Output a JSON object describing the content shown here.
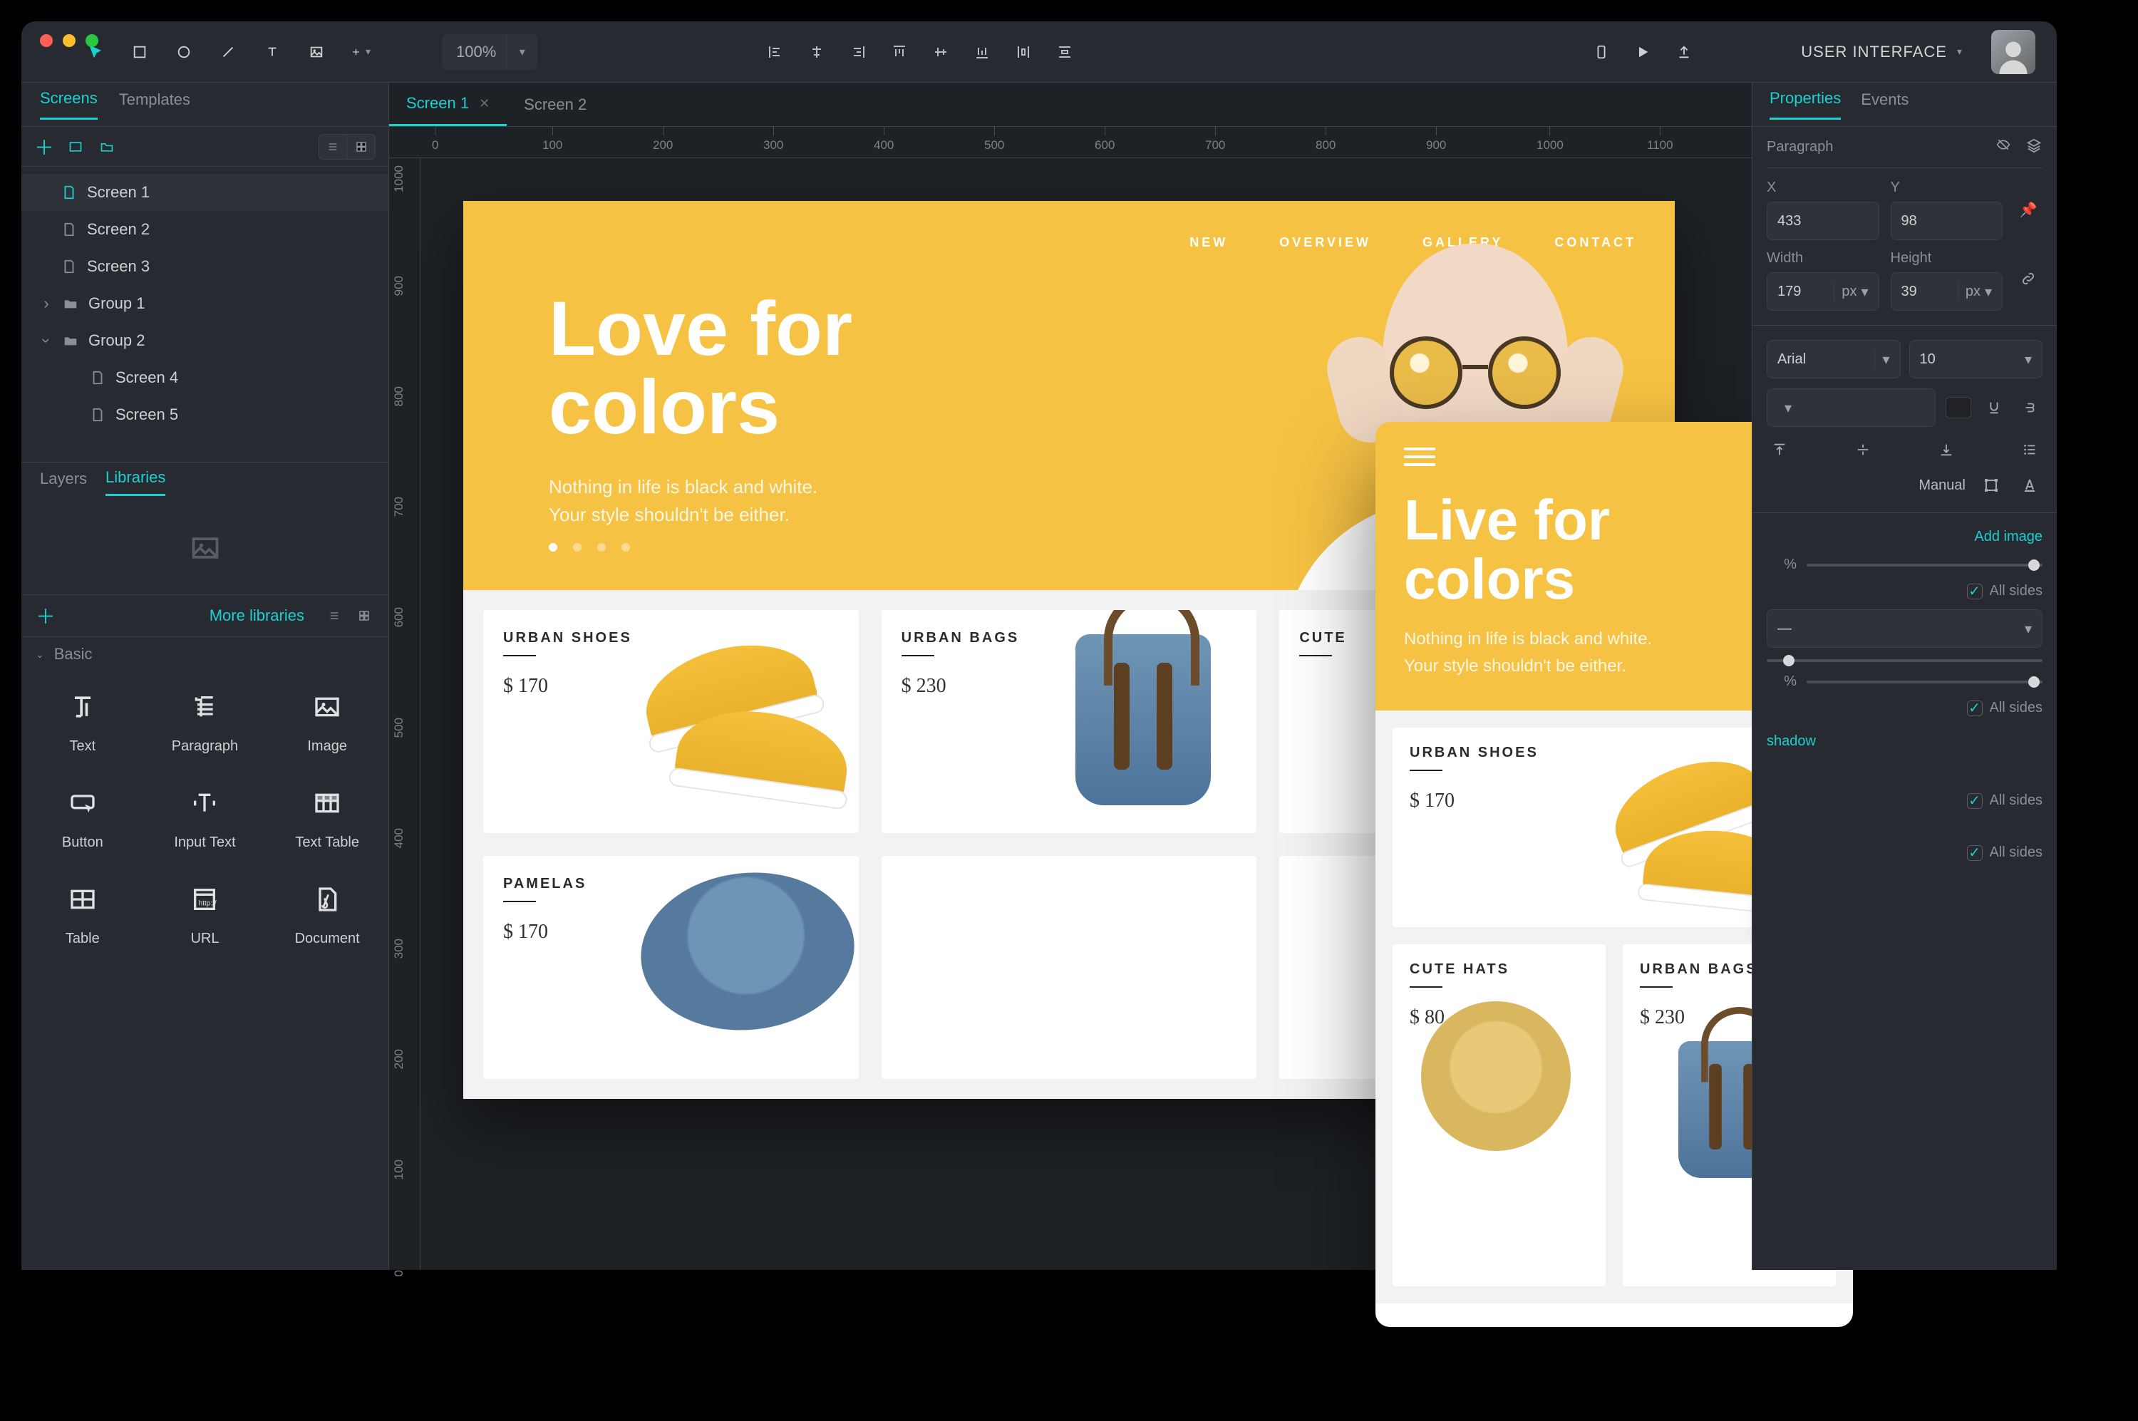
{
  "topbar": {
    "zoom": "100%",
    "mode": "USER INTERFACE"
  },
  "leftPanel": {
    "tabs": [
      "Screens",
      "Templates"
    ],
    "activeTab": "Screens",
    "tree": [
      {
        "label": "Screen 1",
        "type": "screen",
        "selected": true
      },
      {
        "label": "Screen 2",
        "type": "screen"
      },
      {
        "label": "Screen 3",
        "type": "screen"
      },
      {
        "label": "Group 1",
        "type": "group",
        "open": false
      },
      {
        "label": "Group 2",
        "type": "group",
        "open": true,
        "children": [
          {
            "label": "Screen 4",
            "type": "screen"
          },
          {
            "label": "Screen 5",
            "type": "screen"
          }
        ]
      }
    ],
    "bottomTabs": [
      "Layers",
      "Libraries"
    ],
    "activeBottom": "Libraries",
    "moreLibraries": "More libraries",
    "basicHeader": "Basic",
    "components": [
      {
        "label": "Text"
      },
      {
        "label": "Paragraph"
      },
      {
        "label": "Image"
      },
      {
        "label": "Button"
      },
      {
        "label": "Input Text"
      },
      {
        "label": "Text Table"
      },
      {
        "label": "Table"
      },
      {
        "label": "URL"
      },
      {
        "label": "Document"
      }
    ]
  },
  "documentTabs": [
    {
      "label": "Screen 1",
      "active": true
    },
    {
      "label": "Screen 2",
      "active": false
    }
  ],
  "ruler": {
    "ticks": [
      0,
      100,
      200,
      300,
      400,
      500,
      600,
      700,
      800,
      900,
      1000,
      1100
    ],
    "vticks": [
      1000,
      900,
      800,
      700,
      600,
      500,
      400,
      300,
      200,
      100,
      0
    ]
  },
  "desktopMock": {
    "nav": [
      "NEW",
      "OVERVIEW",
      "GALLERY",
      "CONTACT"
    ],
    "headline1": "Love for",
    "headline2": "colors",
    "sub1": "Nothing in life is black and white.",
    "sub2": "Your style shouldn't be either.",
    "products": [
      {
        "title": "URBAN SHOES",
        "price": "$ 170",
        "art": "shoes"
      },
      {
        "title": "URBAN BAGS",
        "price": "$ 230",
        "art": "bag"
      },
      {
        "title": "CUTE",
        "price": "",
        "art": "none"
      },
      {
        "title": "PAMELAS",
        "price": "$ 170",
        "art": "hat"
      }
    ]
  },
  "mobileMock": {
    "headline1": "Live for",
    "headline2": "colors",
    "sub1": "Nothing in life is black and white.",
    "sub2": "Your style shouldn't be either.",
    "products": [
      {
        "title": "URBAN SHOES",
        "price": "$ 170"
      },
      {
        "title": "CUTE HATS",
        "price": "$ 80"
      },
      {
        "title": "URBAN BAGS",
        "price": "$ 230"
      }
    ]
  },
  "props": {
    "tabs": [
      "Properties",
      "Events"
    ],
    "activeTab": "Properties",
    "element": "Paragraph",
    "x": {
      "label": "X",
      "value": "433"
    },
    "y": {
      "label": "Y",
      "value": "98"
    },
    "w": {
      "label": "Width",
      "value": "179",
      "unit": "px"
    },
    "h": {
      "label": "Height",
      "value": "39",
      "unit": "px"
    },
    "font": "Arial",
    "fontSize": "10",
    "opacity1": "%",
    "opacity2": "%",
    "manual": "Manual",
    "addImage": "Add image",
    "allSides": "All sides",
    "addShadow": "shadow"
  }
}
